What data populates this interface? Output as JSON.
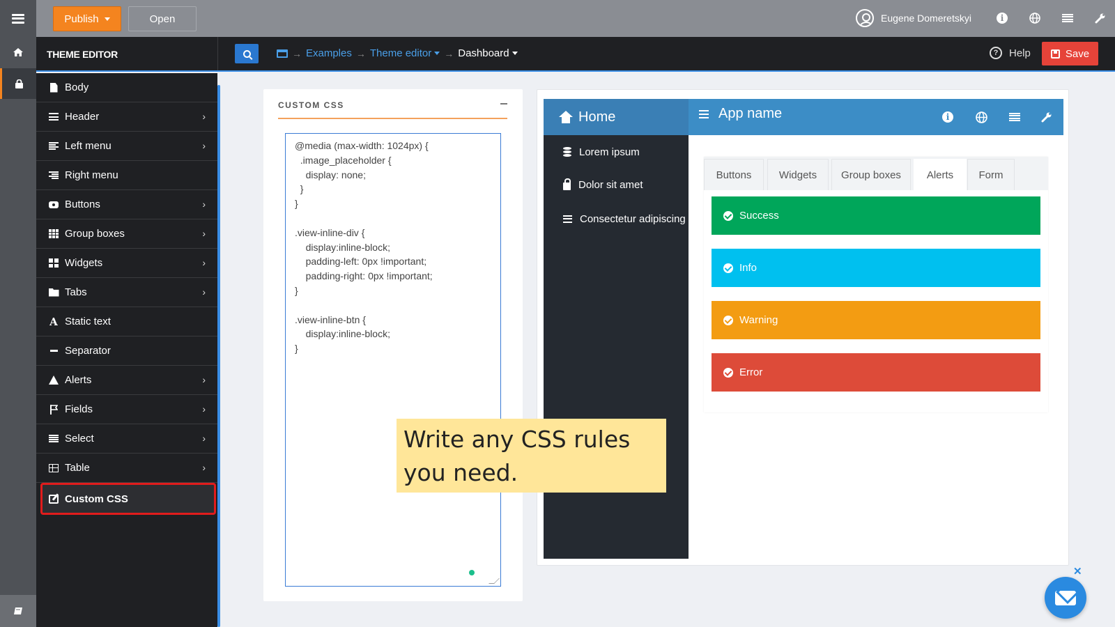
{
  "toolbar": {
    "menu_icon": "hamburger-icon",
    "publish_label": "Publish",
    "open_label": "Open",
    "user_name": "Eugene Domeretskyi",
    "icons": [
      "info-icon",
      "globe-icon",
      "list-icon",
      "wrench-icon"
    ]
  },
  "rail": {
    "icons": [
      "home-icon",
      "lock-icon",
      "book-icon"
    ]
  },
  "header": {
    "panel_title": "THEME EDITOR",
    "breadcrumbs": [
      "Examples",
      "Theme editor",
      "Dashboard"
    ],
    "help_label": "Help",
    "save_label": "Save"
  },
  "sidebar": {
    "items": [
      {
        "label": "Body",
        "icon": "document-icon",
        "has_submenu": false
      },
      {
        "label": "Header",
        "icon": "bars-icon",
        "has_submenu": true
      },
      {
        "label": "Left menu",
        "icon": "align-left-icon",
        "has_submenu": true
      },
      {
        "label": "Right menu",
        "icon": "align-right-icon",
        "has_submenu": false
      },
      {
        "label": "Buttons",
        "icon": "button-icon",
        "has_submenu": true
      },
      {
        "label": "Group boxes",
        "icon": "grid-icon",
        "has_submenu": true
      },
      {
        "label": "Widgets",
        "icon": "widgets-icon",
        "has_submenu": true
      },
      {
        "label": "Tabs",
        "icon": "folder-icon",
        "has_submenu": true
      },
      {
        "label": "Static text",
        "icon": "font-icon",
        "has_submenu": false
      },
      {
        "label": "Separator",
        "icon": "minus-icon",
        "has_submenu": false
      },
      {
        "label": "Alerts",
        "icon": "warning-icon",
        "has_submenu": true
      },
      {
        "label": "Fields",
        "icon": "flag-icon",
        "has_submenu": true
      },
      {
        "label": "Select",
        "icon": "list-icon",
        "has_submenu": true
      },
      {
        "label": "Table",
        "icon": "table-icon",
        "has_submenu": true
      },
      {
        "label": "Custom CSS",
        "icon": "edit-icon",
        "has_submenu": false,
        "active": true
      }
    ]
  },
  "css_panel": {
    "title": "CUSTOM CSS",
    "code": "@media (max-width: 1024px) {\n  .image_placeholder {\n    display: none;\n  }\n}\n\n.view-inline-div {\n    display:inline-block;\n    padding-left: 0px !important;\n    padding-right: 0px !important;\n}\n\n.view-inline-btn {\n    display:inline-block;\n}"
  },
  "preview": {
    "home_label": "Home",
    "app_name": "App name",
    "side_items": [
      {
        "label": "Lorem ipsum",
        "icon": "database-icon"
      },
      {
        "label": "Dolor sit amet",
        "icon": "lock-icon"
      },
      {
        "label": "Consectetur adipiscing",
        "icon": "bars-icon"
      }
    ],
    "tabs": [
      "Buttons",
      "Widgets",
      "Group boxes",
      "Alerts",
      "Form"
    ],
    "active_tab": "Alerts",
    "alerts": [
      {
        "label": "Success",
        "color": "#00a65a"
      },
      {
        "label": "Info",
        "color": "#00c0ef"
      },
      {
        "label": "Warning",
        "color": "#f39c12"
      },
      {
        "label": "Error",
        "color": "#dd4b39"
      }
    ]
  },
  "callout": {
    "text": "Write any CSS rules you need."
  },
  "colors": {
    "accent": "#f4841f",
    "link": "#4a9fe8",
    "save": "#e64339",
    "preview_header": "#3c8dc6",
    "highlight_border": "#e11c1c",
    "callout_bg": "#ffe699"
  },
  "chat_widget": {
    "icon": "envelope-icon",
    "close_icon": "close-icon"
  }
}
